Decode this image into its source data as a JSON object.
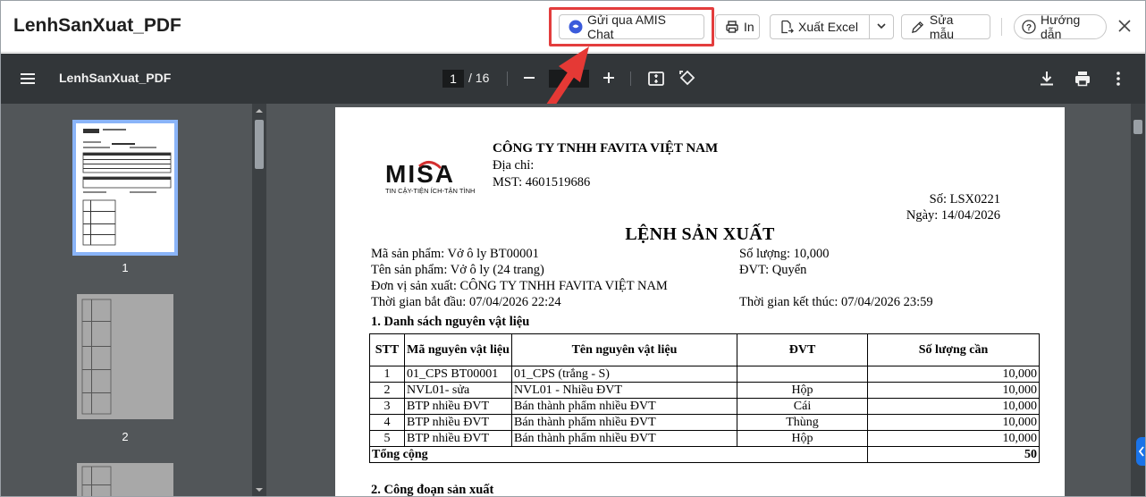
{
  "header": {
    "title": "LenhSanXuat_PDF",
    "chat_label": "Gửi qua AMIS Chat",
    "print_label": "In",
    "excel_label": "Xuất Excel",
    "edit_label": "Sửa mẫu",
    "help_label": "Hướng dẫn"
  },
  "viewer": {
    "doc_name": "LenhSanXuat_PDF",
    "current_page": "1",
    "total_pages": "/ 16",
    "thumbnails": [
      {
        "label": "1"
      },
      {
        "label": "2"
      }
    ]
  },
  "document": {
    "company": "CÔNG TY TNHH FAVITA VIỆT NAM",
    "address_label": "Địa chỉ:",
    "tax_code": "MST: 4601519686",
    "logo_text": "MISA",
    "logo_tagline": "TIN CẬY-TIỆN ÍCH-TẬN TÌNH",
    "number": "Số: LSX0221",
    "date": "Ngày: 14/04/2026",
    "heading": "LỆNH SẢN XUẤT",
    "product_code": "Mã sản phẩm: Vở ô ly BT00001",
    "quantity": "Số lượng:  10,000",
    "product_name": "Tên sản phẩm: Vở ô ly (24 trang)",
    "unit": "ĐVT: Quyển",
    "producer": "Đơn vị sản xuất: CÔNG TY TNHH FAVITA VIỆT NAM",
    "start_time": "Thời gian bắt đầu: 07/04/2026 22:24",
    "end_time": "Thời gian kết thúc: 07/04/2026 23:59",
    "section1": "1. Danh sách nguyên vật liệu",
    "section2": "2. Công đoạn sản xuất",
    "table": {
      "headers": [
        "STT",
        "Mã nguyên vật liệu",
        "Tên nguyên vật liệu",
        "ĐVT",
        "Số lượng cần"
      ],
      "rows": [
        [
          "1",
          "01_CPS BT00001",
          "01_CPS (trắng - S)",
          "",
          "10,000"
        ],
        [
          "2",
          "NVL01- sửa",
          "NVL01 - Nhiều ĐVT",
          "Hộp",
          "10,000"
        ],
        [
          "3",
          "BTP nhiều ĐVT",
          "Bán thành phẩm nhiều ĐVT",
          "Cái",
          "10,000"
        ],
        [
          "4",
          "BTP nhiều ĐVT",
          "Bán thành phẩm nhiều ĐVT",
          "Thùng",
          "10,000"
        ],
        [
          "5",
          "BTP nhiều ĐVT",
          "Bán thành phẩm nhiều ĐVT",
          "Hộp",
          "10,000"
        ]
      ],
      "total_label": "Tổng cộng",
      "total_value": "50"
    }
  },
  "colors": {
    "highlight": "#e33d3d",
    "viewer_toolbar": "#323639",
    "viewer_bg": "#525659",
    "thumb_selected": "#8ab4f8",
    "chat_icon": "#3b5bdb"
  }
}
